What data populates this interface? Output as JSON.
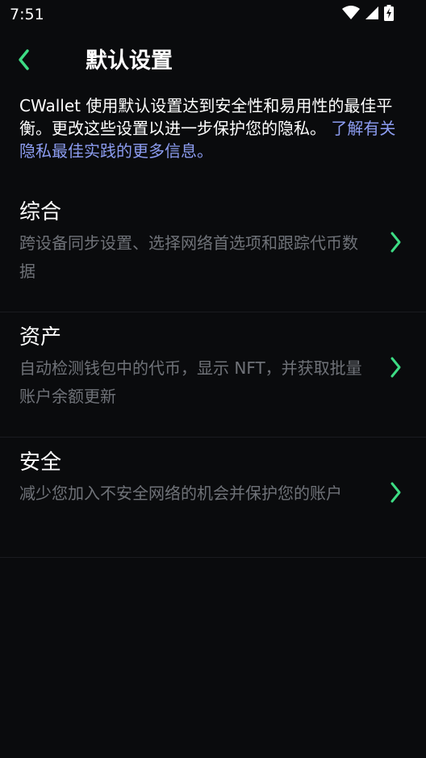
{
  "status_bar": {
    "time": "7:51",
    "icons": [
      "wifi-icon",
      "signal-icon",
      "battery-charging-icon"
    ]
  },
  "header": {
    "back_icon": "chevron-left-icon",
    "title": "默认设置"
  },
  "intro": {
    "text": "CWallet 使用默认设置达到安全性和易用性的最佳平衡。更改这些设置以进一步保护您的隐私。",
    "link": "了解有关隐私最佳实践的更多信息。"
  },
  "settings": {
    "items": [
      {
        "title": "综合",
        "description": "跨设备同步设置、选择网络首选项和跟踪代币数据"
      },
      {
        "title": "资产",
        "description": "自动检测钱包中的代币，显示 NFT，并获取批量账户余额更新"
      },
      {
        "title": "安全",
        "description": "减少您加入不安全网络的机会并保护您的账户"
      }
    ]
  },
  "colors": {
    "background": "#0a0b0d",
    "accent": "#3ddc84",
    "link": "#8c9cf0",
    "secondary_text": "#6f7278"
  }
}
